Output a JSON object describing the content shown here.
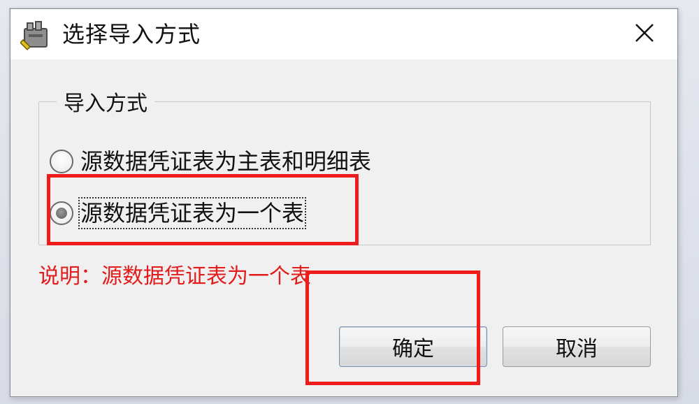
{
  "window": {
    "title": "选择导入方式",
    "icon": "toolbox-app-icon",
    "close_icon": "close-icon"
  },
  "group": {
    "legend": "导入方式",
    "options": [
      {
        "label": "源数据凭证表为主表和明细表",
        "selected": false
      },
      {
        "label": "源数据凭证表为一个表",
        "selected": true
      }
    ]
  },
  "description": {
    "text": "说明：源数据凭证表为一个表"
  },
  "buttons": {
    "ok_label": "确定",
    "cancel_label": "取消"
  },
  "colors": {
    "annotation": "#f01c1c",
    "description_text": "#e31b1b",
    "dialog_bg": "#f0f0f0",
    "titlebar_bg": "#ffffff"
  }
}
